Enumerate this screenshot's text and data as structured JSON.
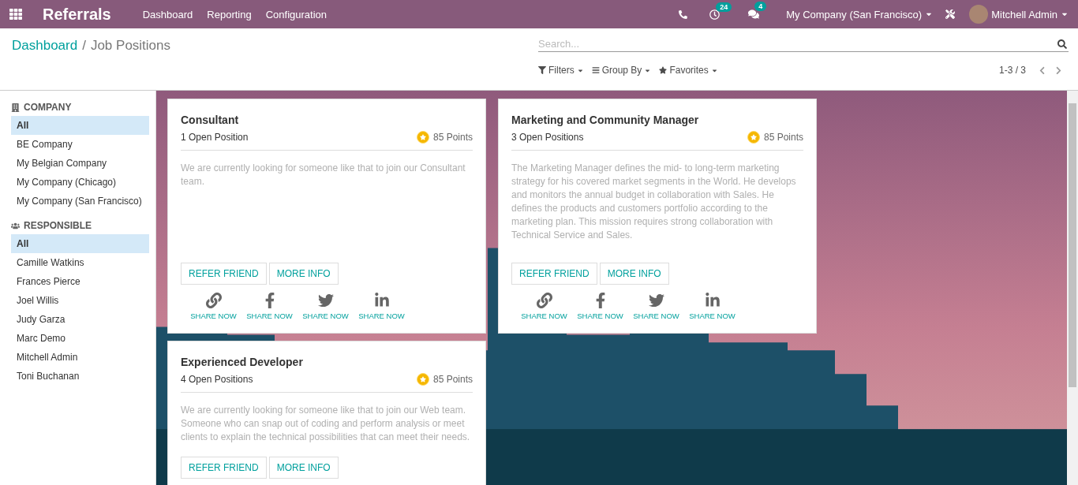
{
  "navbar": {
    "app_name": "Referrals",
    "menu": [
      "Dashboard",
      "Reporting",
      "Configuration"
    ],
    "activity_count": "24",
    "message_count": "4",
    "company": "My Company (San Francisco)",
    "user": "Mitchell Admin"
  },
  "breadcrumb": [
    {
      "label": "Dashboard",
      "kind": "link"
    },
    {
      "label": "/",
      "kind": "separator"
    },
    {
      "label": "Job Positions",
      "kind": "current"
    }
  ],
  "search": {
    "placeholder": "Search..."
  },
  "filters": [
    {
      "label": "Filters",
      "kind": "filter"
    },
    {
      "label": "Group By",
      "kind": "group"
    },
    {
      "label": "Favorites",
      "kind": "favorite"
    }
  ],
  "pager": "1-3 / 3",
  "sidebar": [
    {
      "title": "COMPANY",
      "kind": "company",
      "items": [
        {
          "label": "All",
          "selected": true
        },
        {
          "label": "BE Company",
          "selected": false
        },
        {
          "label": "My Belgian Company",
          "selected": false
        },
        {
          "label": "My Company (Chicago)",
          "selected": false
        },
        {
          "label": "My Company (San Francisco)",
          "selected": false
        }
      ]
    },
    {
      "title": "RESPONSIBLE",
      "kind": "people",
      "items": [
        {
          "label": "All",
          "selected": true
        },
        {
          "label": "Camille Watkins",
          "selected": false
        },
        {
          "label": "Frances Pierce",
          "selected": false
        },
        {
          "label": "Joel Willis",
          "selected": false
        },
        {
          "label": "Judy Garza",
          "selected": false
        },
        {
          "label": "Marc Demo",
          "selected": false
        },
        {
          "label": "Mitchell Admin",
          "selected": false
        },
        {
          "label": "Toni Buchanan",
          "selected": false
        }
      ]
    }
  ],
  "jobs": [
    {
      "title": "Consultant",
      "positions": "1 Open Position",
      "points": "85 Points",
      "description": "We are currently looking for someone like that to join our Consultant team.",
      "buttons": [
        "REFER FRIEND",
        "MORE INFO"
      ],
      "shares": [
        {
          "kind": "link",
          "label": "SHARE NOW"
        },
        {
          "kind": "facebook",
          "label": "SHARE NOW"
        },
        {
          "kind": "twitter",
          "label": "SHARE NOW"
        },
        {
          "kind": "linkedin",
          "label": "SHARE NOW"
        }
      ]
    },
    {
      "title": "Marketing and Community Manager",
      "positions": "3 Open Positions",
      "points": "85 Points",
      "description": "The Marketing Manager defines the mid- to long-term marketing strategy for his covered market segments in the World. He develops and monitors the annual budget in collaboration with Sales. He defines the products and customers portfolio according to the marketing plan. This mission requires strong collaboration with Technical Service and Sales.",
      "buttons": [
        "REFER FRIEND",
        "MORE INFO"
      ],
      "shares": [
        {
          "kind": "link",
          "label": "SHARE NOW"
        },
        {
          "kind": "facebook",
          "label": "SHARE NOW"
        },
        {
          "kind": "twitter",
          "label": "SHARE NOW"
        },
        {
          "kind": "linkedin",
          "label": "SHARE NOW"
        }
      ]
    },
    {
      "title": "Experienced Developer",
      "positions": "4 Open Positions",
      "points": "85 Points",
      "description": "We are currently looking for someone like that to join our Web team. Someone who can snap out of coding and perform analysis or meet clients to explain the technical possibilities that can meet their needs.",
      "buttons": [
        "REFER FRIEND",
        "MORE INFO"
      ]
    }
  ]
}
